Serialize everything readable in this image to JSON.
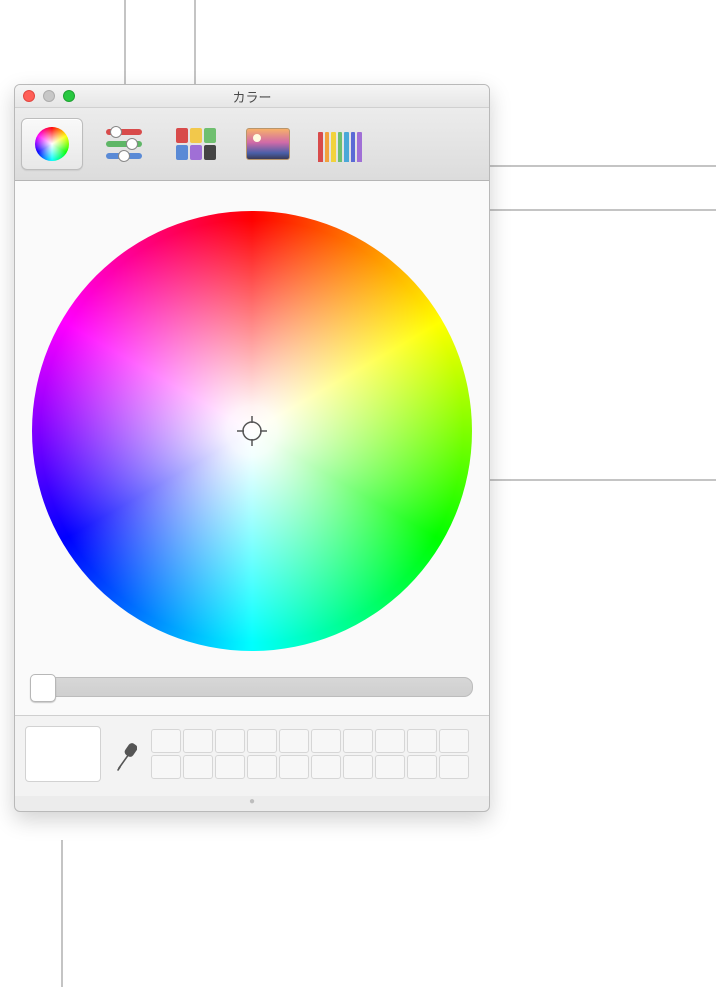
{
  "window": {
    "title": "カラー"
  },
  "tabs": {
    "wheel": {
      "name": "color-wheel"
    },
    "sliders": {
      "name": "color-sliders"
    },
    "palettes": {
      "name": "color-palettes"
    },
    "image": {
      "name": "image-palettes"
    },
    "pencils": {
      "name": "pencils"
    }
  },
  "slider": {
    "value_percent": 0
  },
  "current_color": "#ffffff",
  "swatch_count": 20,
  "icons": {
    "slider_colors": [
      "#d84b4b",
      "#5fb667",
      "#5a8ad6"
    ],
    "palette_colors": [
      "#d84b4b",
      "#f2c84b",
      "#6fbf6f",
      "#5a8ad6",
      "#a06fd6",
      "#444444"
    ],
    "pencil_colors": [
      "#d84b4b",
      "#f2a23c",
      "#f2d23c",
      "#6fbf6f",
      "#4aa8d8",
      "#5a6ad6",
      "#a06fd6"
    ]
  }
}
